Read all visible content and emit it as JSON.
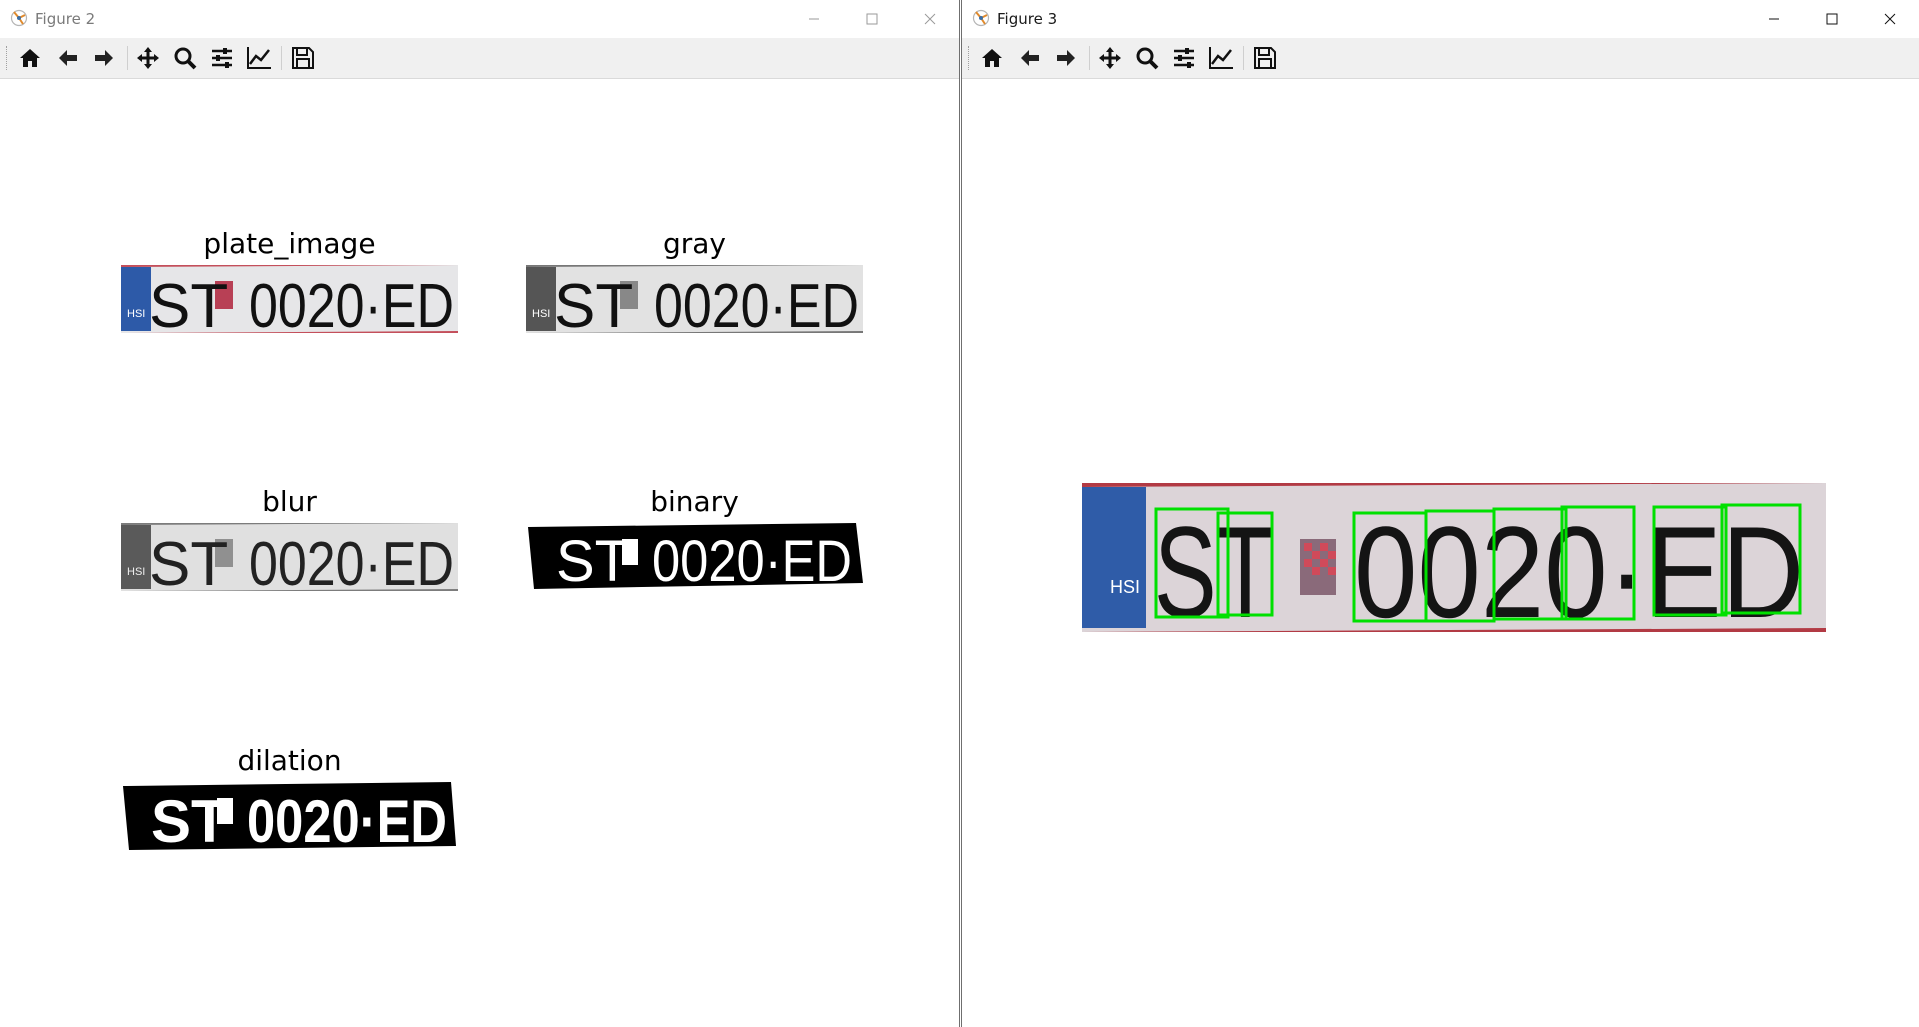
{
  "figure2": {
    "title": "Figure 2",
    "panels": [
      {
        "key": "plate_image",
        "title": "plate_image"
      },
      {
        "key": "gray",
        "title": "gray"
      },
      {
        "key": "blur",
        "title": "blur"
      },
      {
        "key": "binary",
        "title": "binary"
      },
      {
        "key": "dilation",
        "title": "dilation"
      }
    ]
  },
  "figure3": {
    "title": "Figure 3"
  },
  "plate": {
    "text_left": "ST",
    "text_right": "0020·ED",
    "badge": "HSI",
    "box_color": "#00e000"
  },
  "toolbar": [
    "home-icon",
    "back-icon",
    "forward-icon",
    "pan-icon",
    "zoom-icon",
    "configure-subplots-icon",
    "edit-axis-icon",
    "save-icon"
  ]
}
